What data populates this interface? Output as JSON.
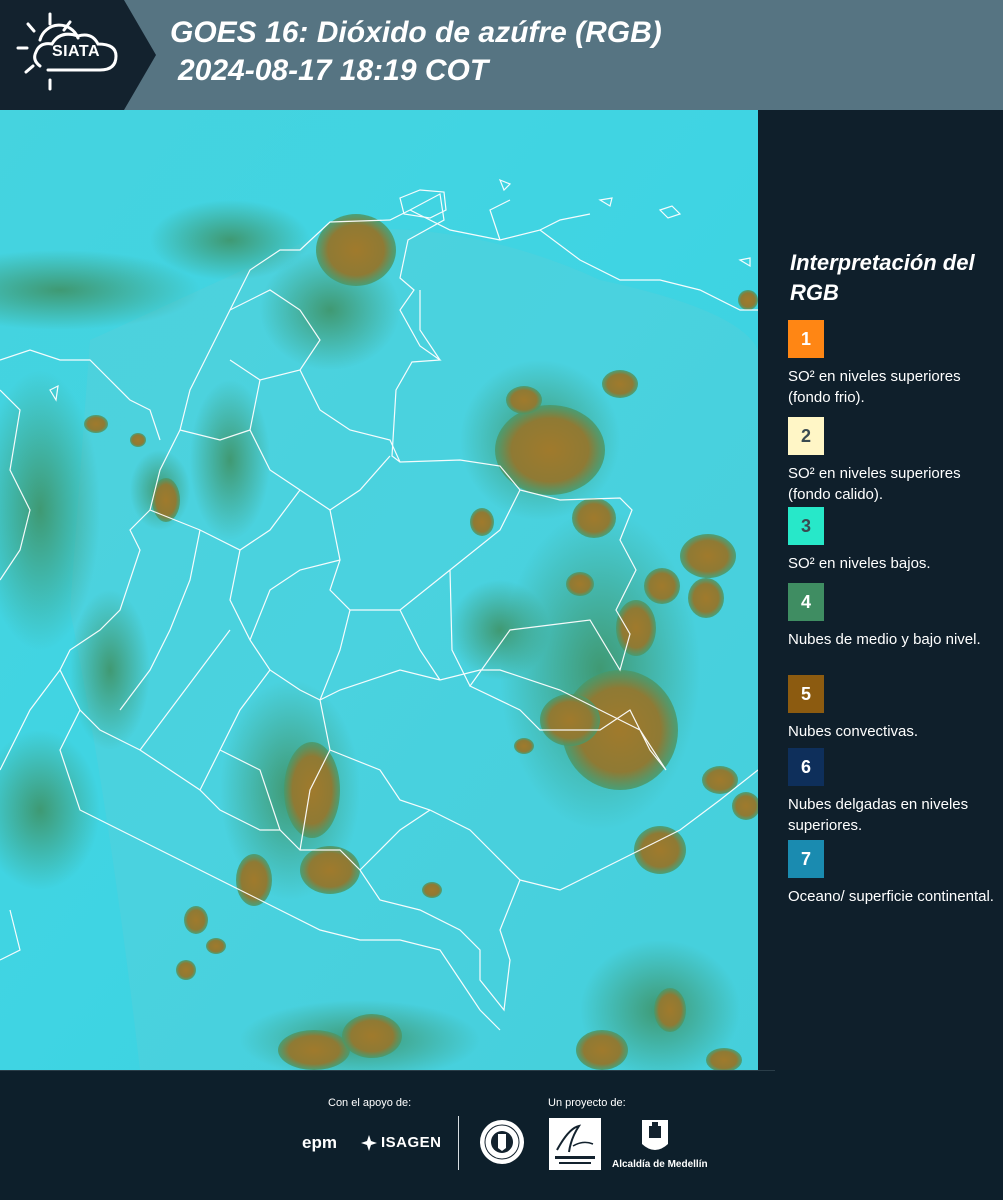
{
  "header": {
    "logo_text": "SIATA",
    "title": "GOES 16: Dióxido de azúfre (RGB)",
    "subtitle": "2024-08-17 18:19 COT",
    "bg_color": "#567482",
    "logo_bg_color": "#13222e"
  },
  "map": {
    "background_color": "#39d2e0",
    "cloud_convective_color": "#9b7a2e",
    "cloud_low_color": "#3e8f60",
    "boundary_color": "#ffffff"
  },
  "legend": {
    "title": "Interpretación del RGB",
    "items": [
      {
        "number": "1",
        "color": "#ff8614",
        "label": "SO² en niveles superiores (fondo frio)."
      },
      {
        "number": "2",
        "color": "#fff6c6",
        "label": "SO² en niveles superiores (fondo calido)."
      },
      {
        "number": "3",
        "color": "#27e8c9",
        "label": "SO² en niveles bajos."
      },
      {
        "number": "4",
        "color": "#3f8d62",
        "label": "Nubes de medio y bajo nivel."
      },
      {
        "number": "5",
        "color": "#8c5b10",
        "label": "Nubes convectivas."
      },
      {
        "number": "6",
        "color": "#0e2f5b",
        "label": "Nubes delgadas en niveles superiores."
      },
      {
        "number": "7",
        "color": "#1a8bb0",
        "label": "Oceano/ superficie continental."
      }
    ]
  },
  "footer": {
    "support_label": "Con el apoyo de:",
    "project_label": "Un proyecto de:",
    "epm": "epm",
    "isagen": "ISAGEN",
    "alcaldia": "Alcaldía de Medellín"
  }
}
